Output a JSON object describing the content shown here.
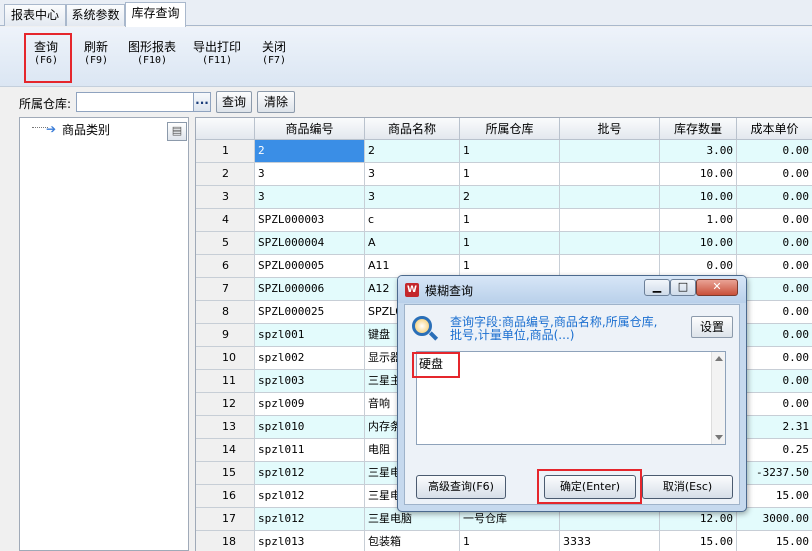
{
  "tabs": [
    {
      "label": "报表中心"
    },
    {
      "label": "系统参数"
    },
    {
      "label": "库存查询"
    }
  ],
  "toolbar": {
    "query": {
      "label": "查询",
      "key": "(F6)"
    },
    "refresh": {
      "label": "刷新",
      "key": "(F9)"
    },
    "chart": {
      "label": "图形报表",
      "key": "(F10)"
    },
    "export": {
      "label": "导出打印",
      "key": "(F11)"
    },
    "close": {
      "label": "关闭",
      "key": "(F7)"
    }
  },
  "filter": {
    "label": "所属仓库:",
    "value": "",
    "browse_label": "...",
    "query_label": "查询",
    "clear_label": "清除"
  },
  "tree": {
    "root_label": "商品类别"
  },
  "grid": {
    "columns": [
      "",
      "商品编号",
      "商品名称",
      "所属仓库",
      "批号",
      "库存数量",
      "成本单价"
    ],
    "rows": [
      [
        "1",
        "2",
        "2",
        "1",
        "",
        "3.00",
        "0.00"
      ],
      [
        "2",
        "3",
        "3",
        "1",
        "",
        "10.00",
        "0.00"
      ],
      [
        "3",
        "3",
        "3",
        "2",
        "",
        "10.00",
        "0.00"
      ],
      [
        "4",
        "SPZL000003",
        "c",
        "1",
        "",
        "1.00",
        "0.00"
      ],
      [
        "5",
        "SPZL000004",
        "A",
        "1",
        "",
        "10.00",
        "0.00"
      ],
      [
        "6",
        "SPZL000005",
        "A11",
        "1",
        "",
        "0.00",
        "0.00"
      ],
      [
        "7",
        "SPZL000006",
        "A12",
        "",
        "",
        "",
        "0.00"
      ],
      [
        "8",
        "SPZL000025",
        "SPZL0",
        "",
        "",
        "",
        "0.00"
      ],
      [
        "9",
        "spzl001",
        "键盘",
        "",
        "",
        "",
        "0.00"
      ],
      [
        "10",
        "spzl002",
        "显示器",
        "",
        "",
        "",
        "0.00"
      ],
      [
        "11",
        "spzl003",
        "三星主",
        "",
        "",
        "",
        "0.00"
      ],
      [
        "12",
        "spzl009",
        "音响",
        "",
        "",
        "",
        "0.00"
      ],
      [
        "13",
        "spzl010",
        "内存条",
        "",
        "",
        "",
        "2.31"
      ],
      [
        "14",
        "spzl011",
        "电阻",
        "",
        "",
        "",
        "0.25"
      ],
      [
        "15",
        "spzl012",
        "三星电",
        "",
        "",
        "",
        "-3237.50"
      ],
      [
        "16",
        "spzl012",
        "三星电",
        "",
        "",
        "",
        "15.00"
      ],
      [
        "17",
        "spzl012",
        "三星电脑",
        "一号仓库",
        "",
        "12.00",
        "3000.00"
      ],
      [
        "18",
        "spzl013",
        "包装箱",
        "1",
        "3333",
        "15.00",
        "15.00"
      ]
    ]
  },
  "dialog": {
    "title": "模糊查询",
    "hint": "查询字段:商品编号,商品名称,所属仓库,批号,计量单位,商品(...)",
    "settings_label": "设置",
    "query_text": "硬盘",
    "advanced_label": "高级查询(F6)",
    "ok_label": "确定(Enter)",
    "cancel_label": "取消(Esc)"
  }
}
